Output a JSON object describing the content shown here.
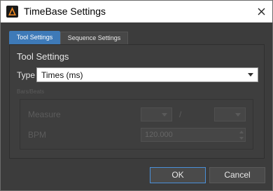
{
  "window": {
    "title": "TimeBase Settings"
  },
  "tabs": [
    {
      "label": "Tool Settings",
      "active": true
    },
    {
      "label": "Sequence Settings",
      "active": false
    }
  ],
  "section": {
    "title": "Tool Settings"
  },
  "type_field": {
    "label": "Type",
    "value": "Times (ms)"
  },
  "bars_beats": {
    "title": "Bars/Beats",
    "measure_label": "Measure",
    "separator": "/",
    "bpm_label": "BPM",
    "bpm_value": "120.000"
  },
  "buttons": {
    "ok": "OK",
    "cancel": "Cancel"
  },
  "colors": {
    "accent": "#3e7ab8",
    "background": "#3c3c3c",
    "titlebar": "#ffffff"
  }
}
